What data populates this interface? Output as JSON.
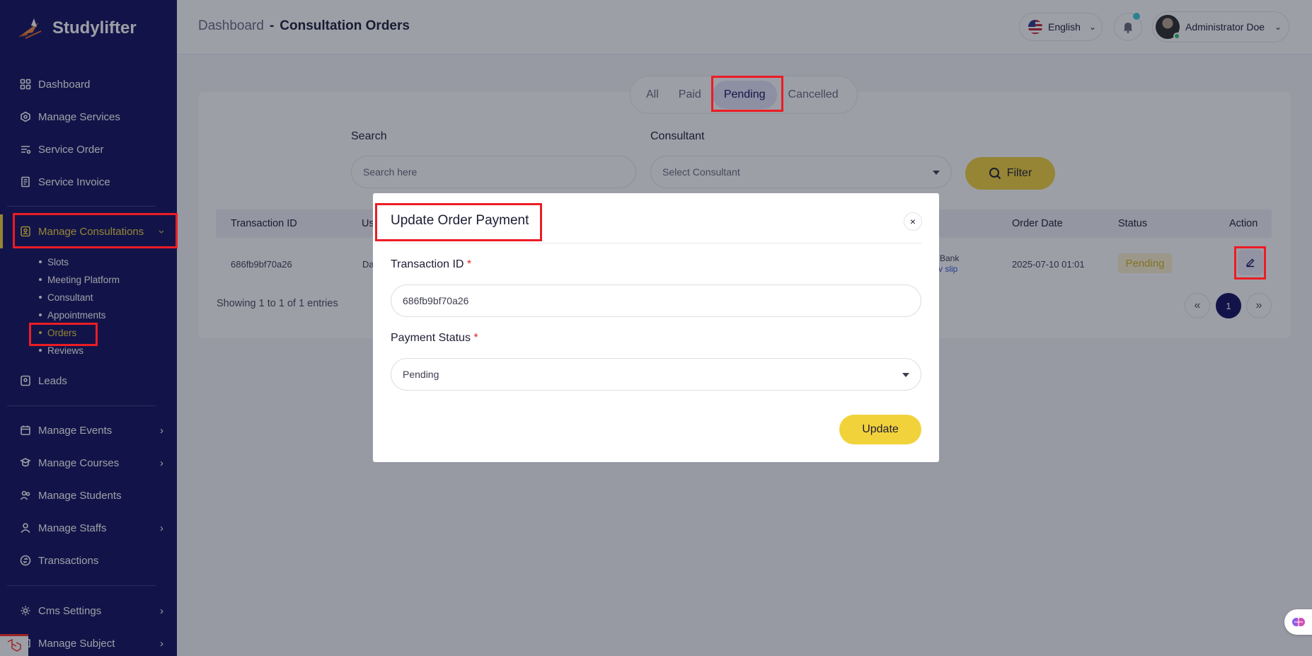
{
  "brand": {
    "name": "Studylifter"
  },
  "sidebar": {
    "items": [
      {
        "label": "Dashboard",
        "icon": "dashboard-icon"
      },
      {
        "label": "Manage Services",
        "icon": "services-icon"
      },
      {
        "label": "Service Order",
        "icon": "order-icon"
      },
      {
        "label": "Service Invoice",
        "icon": "invoice-icon"
      },
      {
        "label": "Manage Consultations",
        "icon": "consultation-icon"
      },
      {
        "label": "Leads",
        "icon": "leads-icon"
      },
      {
        "label": "Manage Events",
        "icon": "calendar-icon"
      },
      {
        "label": "Manage Courses",
        "icon": "courses-icon"
      },
      {
        "label": "Manage Students",
        "icon": "students-icon"
      },
      {
        "label": "Manage Staffs",
        "icon": "staffs-icon"
      },
      {
        "label": "Transactions",
        "icon": "transactions-icon"
      },
      {
        "label": "Cms Settings",
        "icon": "settings-icon"
      },
      {
        "label": "Manage Subject",
        "icon": "subject-icon"
      }
    ],
    "sub_items": [
      "Slots",
      "Meeting Platform",
      "Consultant",
      "Appointments",
      "Orders",
      "Reviews"
    ]
  },
  "header": {
    "breadcrumb_root": "Dashboard",
    "breadcrumb_sep": "-",
    "breadcrumb_current": "Consultation Orders",
    "language": "English",
    "user_name": "Administrator Doe"
  },
  "tabs": [
    "All",
    "Paid",
    "Pending",
    "Cancelled"
  ],
  "filters": {
    "search_label": "Search",
    "search_placeholder": "Search here",
    "consultant_label": "Consultant",
    "consultant_placeholder": "Select Consultant",
    "filter_button": "Filter"
  },
  "table": {
    "columns": [
      "Transaction ID",
      "Us",
      "Order Date",
      "Status",
      "Action"
    ],
    "row": {
      "transaction_id": "686fb9bf70a26",
      "user_fragment": "Da",
      "gateway_fragment": "Bank",
      "slip_fragment": "v slip",
      "order_date": "2025-07-10 01:01",
      "status": "Pending"
    },
    "entries_text": "Showing 1 to 1 of 1 entries",
    "pagination": {
      "prev": "«",
      "current": "1",
      "next": "»"
    }
  },
  "modal": {
    "title": "Update Order Payment",
    "close": "×",
    "transaction_label": "Transaction ID",
    "payment_status_label": "Payment Status",
    "required_mark": "*",
    "transaction_value": "686fb9bf70a26",
    "payment_status_value": "Pending",
    "update_button": "Update"
  },
  "colors": {
    "sidebar_bg": "#11115e",
    "accent": "#f2d23a",
    "highlight": "#ec1c24",
    "pending_text": "#d6b21c"
  }
}
